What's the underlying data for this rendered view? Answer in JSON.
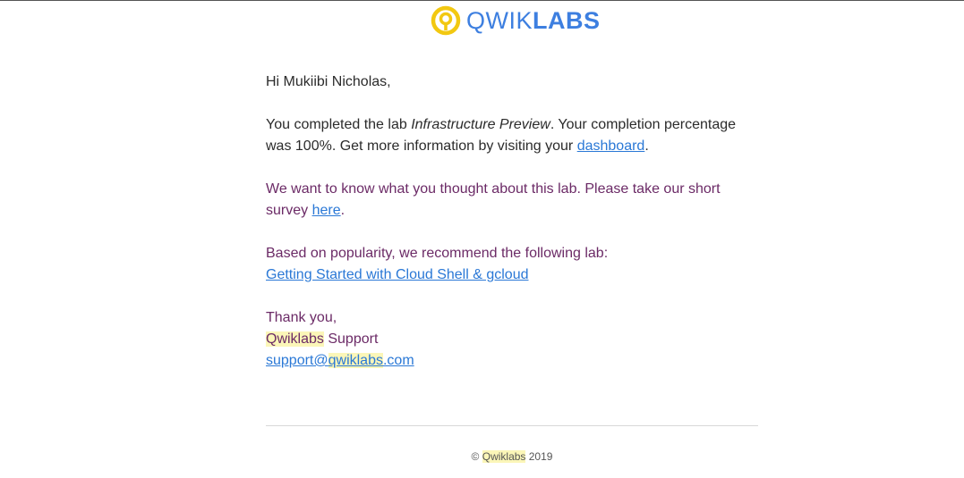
{
  "brand": {
    "name_light": "QWIK",
    "name_bold": "LABS",
    "logo_color": "#f2c811",
    "text_color": "#3d7fe0"
  },
  "email": {
    "greeting": "Hi Mukiibi Nicholas,",
    "completion": {
      "prefix": "You completed the lab ",
      "lab_name": "Infrastructure Preview",
      "middle": ". Your completion percentage was 100%. Get more information by visiting your ",
      "dashboard_link": "dashboard",
      "suffix": "."
    },
    "survey": {
      "prefix": "We want to know what you thought about this lab. Please take our short survey ",
      "link": "here",
      "suffix": "."
    },
    "recommendation": {
      "intro": "Based on popularity, we recommend the following lab:",
      "link": "Getting Started with Cloud Shell & gcloud"
    },
    "signoff": {
      "thanks": "Thank you,",
      "team_highlight": "Qwiklabs",
      "team_rest": " Support",
      "email_prefix": "support@",
      "email_highlight": "qwiklabs",
      "email_suffix": ".com"
    }
  },
  "footer": {
    "copyright_symbol": "© ",
    "company": "Qwiklabs",
    "year": " 2019"
  }
}
